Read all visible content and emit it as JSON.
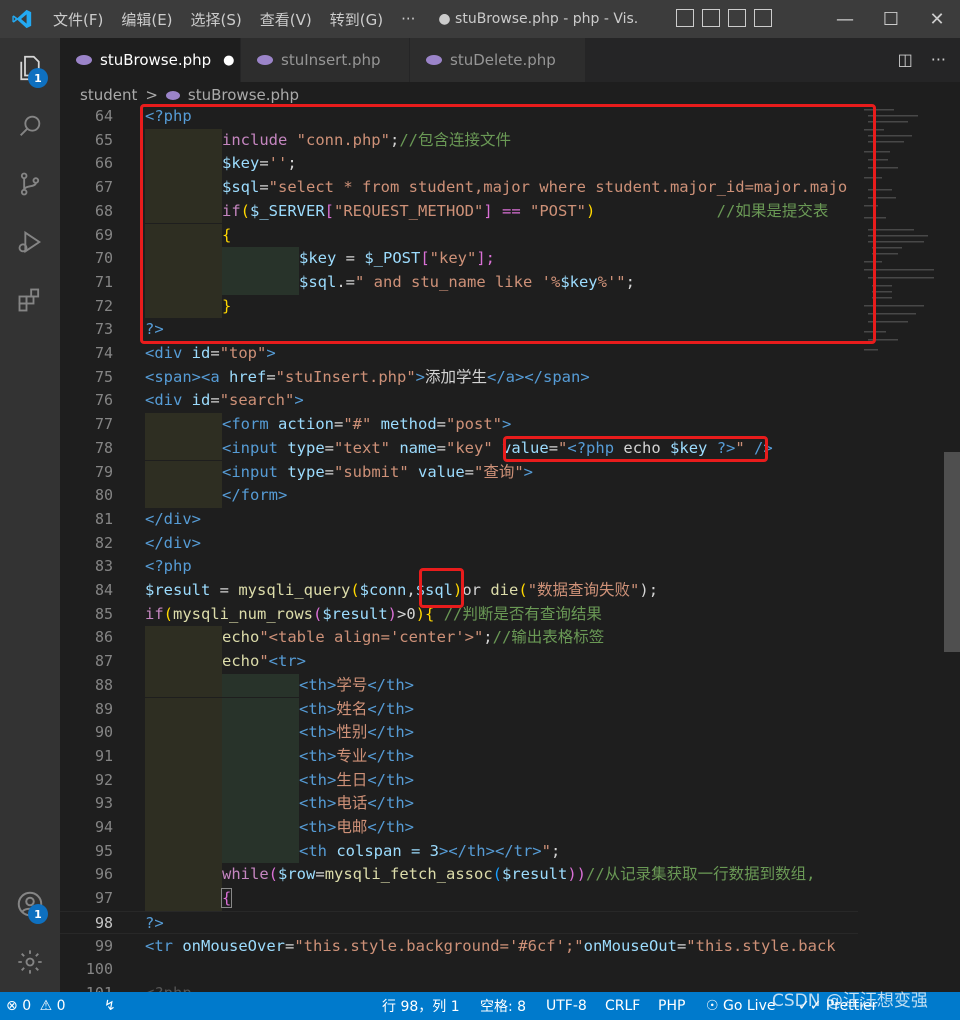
{
  "menu": [
    "文件(F)",
    "编辑(E)",
    "选择(S)",
    "查看(V)",
    "转到(G)",
    "···"
  ],
  "window_title": "● stuBrowse.php - php - Vis...",
  "tabs": [
    {
      "label": "stuBrowse.php",
      "active": true,
      "modified": true
    },
    {
      "label": "stuInsert.php",
      "active": false
    },
    {
      "label": "stuDelete.php",
      "active": false
    }
  ],
  "breadcrumb": {
    "folder": "student",
    "sep": ">",
    "file": "stuBrowse.php"
  },
  "activity_badges": {
    "explorer": "1",
    "accounts": "1"
  },
  "line_numbers": [
    "64",
    "65",
    "66",
    "67",
    "68",
    "69",
    "70",
    "71",
    "72",
    "73",
    "74",
    "75",
    "76",
    "77",
    "78",
    "79",
    "80",
    "81",
    "82",
    "83",
    "84",
    "85",
    "86",
    "87",
    "88",
    "89",
    "90",
    "91",
    "92",
    "93",
    "94",
    "95",
    "96",
    "97",
    "98",
    "99",
    "100",
    "101"
  ],
  "code": {
    "l64": "<?php",
    "l65_a": "include ",
    "l65_b": "\"conn.php\"",
    "l65_c": ";",
    "l65_d": "//包含连接文件",
    "l66_a": "$key",
    "l66_b": "=",
    "l66_c": "''",
    "l66_d": ";",
    "l67_a": "$sql",
    "l67_b": "=",
    "l67_c": "\"select * from student,major where student.major_id=major.majo",
    "l68_a": "if",
    "l68_b": "(",
    "l68_c": "$_SERVER",
    "l68_d": "[",
    "l68_e": "\"REQUEST_METHOD\"",
    "l68_f": "] == ",
    "l68_g": "\"POST\"",
    "l68_h": ")",
    "l68_i": "//如果是提交表",
    "l69": "{",
    "l70_a": "$key",
    "l70_b": " = ",
    "l70_c": "$_POST",
    "l70_d": "[",
    "l70_e": "\"key\"",
    "l70_f": "];",
    "l71_a": "$sql",
    "l71_b": ".=",
    "l71_c": "\" and stu_name like '%",
    "l71_d": "$key",
    "l71_e": "%'\"",
    "l71_f": ";",
    "l72": "}",
    "l73": "?>",
    "l74_a": "<div ",
    "l74_b": "id",
    "l74_c": "=",
    "l74_d": "\"top\"",
    "l74_e": ">",
    "l75_a": "<span><a ",
    "l75_b": "href",
    "l75_c": "=",
    "l75_d": "\"stuInsert.php\"",
    "l75_e": ">",
    "l75_f": "添加学生",
    "l75_g": "</a></span>",
    "l76_a": "<div ",
    "l76_b": "id",
    "l76_c": "=",
    "l76_d": "\"search\"",
    "l76_e": ">",
    "l77_a": "<form ",
    "l77_b": "action",
    "l77_c": "=",
    "l77_d": "\"#\"",
    "l77_e": " method",
    "l77_f": "=",
    "l77_g": "\"post\"",
    "l77_h": ">",
    "l78_a": "<input ",
    "l78_b": "type",
    "l78_c": "=",
    "l78_d": "\"text\"",
    "l78_e": " name",
    "l78_f": "=",
    "l78_g": "\"key\"",
    "l78_h": " value",
    "l78_i": "=",
    "l78_j": "\"",
    "l78_k": "<?php",
    "l78_l": " echo ",
    "l78_m": "$key",
    "l78_n": " ?>",
    "l78_o": "\"",
    "l78_p": " />",
    "l79_a": "<input ",
    "l79_b": "type",
    "l79_c": "=",
    "l79_d": "\"submit\"",
    "l79_e": " value",
    "l79_f": "=",
    "l79_g": "\"查询\"",
    "l79_h": ">",
    "l80": "</form>",
    "l81": "</div>",
    "l82": "</div>",
    "l83": "<?php",
    "l84_a": "$result",
    "l84_b": " = ",
    "l84_c": "mysqli_query",
    "l84_d": "(",
    "l84_e": "$conn",
    "l84_f": ",",
    "l84_g": "$sql",
    "l84_h": ")",
    "l84_i": "or ",
    "l84_j": "die",
    "l84_k": "(",
    "l84_l": "\"数据查询失败\"",
    "l84_m": ");",
    "l85_a": "if",
    "l85_b": "(",
    "l85_c": "mysqli_num_rows",
    "l85_d": "(",
    "l85_e": "$result",
    "l85_f": ")",
    "l85_g": ">0",
    "l85_h": ")",
    "l85_i": "{ ",
    "l85_j": "//判断是否有查询结果",
    "l86_a": "echo",
    "l86_b": "\"<table align='center'>\"",
    "l86_c": ";",
    "l86_d": "//输出表格标签",
    "l87_a": "echo",
    "l87_b": "\"",
    "l87_c": "<tr>",
    "th_rows": [
      "学号",
      "姓名",
      "性别",
      "专业",
      "生日",
      "电话",
      "电邮"
    ],
    "th_open": "<th>",
    "th_close": "</th>",
    "l95_a": "<th ",
    "l95_b": "colspan = 3",
    "l95_c": "></th></tr>",
    "l95_d": "\"",
    "l95_e": ";",
    "l96_a": "while",
    "l96_b": "(",
    "l96_c": "$row",
    "l96_d": "=",
    "l96_e": "mysqli_fetch_assoc",
    "l96_f": "(",
    "l96_g": "$result",
    "l96_h": "))",
    "l96_i": "//从记录集获取一行数据到数组,",
    "l97": "{",
    "l98": "?>",
    "l99_a": "<tr ",
    "l99_b": "onMouseOver",
    "l99_c": "=",
    "l99_d": "\"this.style.background='#6cf';\"",
    "l99_e": "onMouseOut",
    "l99_f": "=",
    "l99_g": "\"this.style.back",
    "l101": "<?php"
  },
  "status": {
    "errors": "0",
    "warnings": "0",
    "position": "行 98，列 1",
    "spaces": "空格: 8",
    "encoding": "UTF-8",
    "eol": "CRLF",
    "language": "PHP",
    "golive": "Go Live",
    "prettier": "Prettier",
    "watermark": "CSDN @汪汪想变强"
  },
  "colors": {
    "accent": "#007acc",
    "highlight_box": "#e81c1c"
  }
}
